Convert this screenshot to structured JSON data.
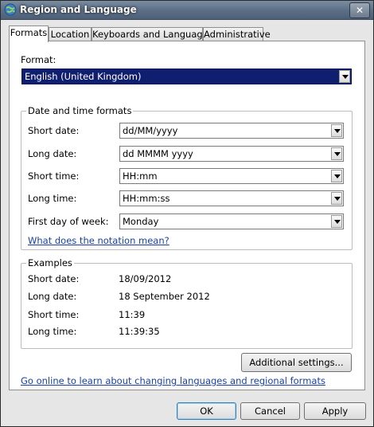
{
  "window": {
    "title": "Region and Language"
  },
  "tabs": [
    {
      "label": "Formats",
      "active": true
    },
    {
      "label": "Location"
    },
    {
      "label": "Keyboards and Languages"
    },
    {
      "label": "Administrative"
    }
  ],
  "format": {
    "label": "Format:",
    "value": "English (United Kingdom)"
  },
  "datetime": {
    "title": "Date and time formats",
    "short_date": {
      "label": "Short date:",
      "value": "dd/MM/yyyy"
    },
    "long_date": {
      "label": "Long date:",
      "value": "dd MMMM yyyy"
    },
    "short_time": {
      "label": "Short time:",
      "value": "HH:mm"
    },
    "long_time": {
      "label": "Long time:",
      "value": "HH:mm:ss"
    },
    "first_day": {
      "label": "First day of week:",
      "value": "Monday"
    },
    "notation_link": "What does the notation mean?"
  },
  "examples": {
    "title": "Examples",
    "short_date": {
      "label": "Short date:",
      "value": "18/09/2012"
    },
    "long_date": {
      "label": "Long date:",
      "value": "18 September 2012"
    },
    "short_time": {
      "label": "Short time:",
      "value": "11:39"
    },
    "long_time": {
      "label": "Long time:",
      "value": "11:39:35"
    }
  },
  "additional_settings_label": "Additional settings...",
  "online_link": "Go online to learn about changing languages and regional formats",
  "buttons": {
    "ok": "OK",
    "cancel": "Cancel",
    "apply": "Apply"
  },
  "icons": {
    "app": "globe-icon",
    "close": "close-icon",
    "dropdown": "chevron-down-icon"
  }
}
